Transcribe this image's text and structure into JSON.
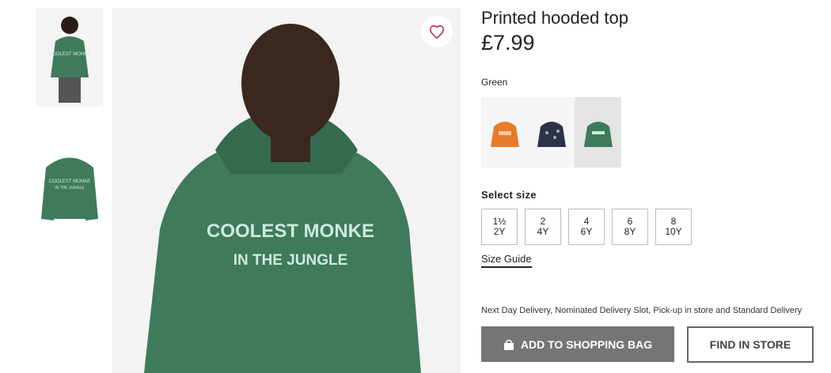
{
  "product": {
    "title": "Printed hooded top",
    "price": "£7.99",
    "color_name": "Green",
    "print_text_line1": "COOLEST MONKE",
    "print_text_line2": "IN THE JUNGLE",
    "thumb_print_line1": "COOLEST MONKE",
    "thumb_print_line2": "IN THE JUNGLE"
  },
  "swatches": [
    {
      "name": "orange",
      "color": "#e87a2a"
    },
    {
      "name": "navy",
      "color": "#2c3346"
    },
    {
      "name": "green",
      "color": "#3e7a5a",
      "selected": true
    }
  ],
  "sizes": {
    "label": "Select size",
    "options": [
      {
        "top": "1½",
        "bottom": "2Y"
      },
      {
        "top": "2",
        "bottom": "4Y"
      },
      {
        "top": "4",
        "bottom": "6Y"
      },
      {
        "top": "6",
        "bottom": "8Y"
      },
      {
        "top": "8",
        "bottom": "10Y"
      }
    ]
  },
  "size_guide_label": "Size Guide",
  "delivery_text": "Next Day Delivery, Nominated Delivery Slot, Pick-up in store and Standard Delivery",
  "buttons": {
    "add_to_bag": "ADD TO SHOPPING BAG",
    "find_in_store": "FIND IN STORE"
  },
  "icons": {
    "wishlist": "heart-icon",
    "bag": "shopping-bag-icon"
  },
  "colors": {
    "hoodie_green": "#3f7a5c",
    "print_color": "#cfe9df",
    "heart": "#c3324a"
  }
}
